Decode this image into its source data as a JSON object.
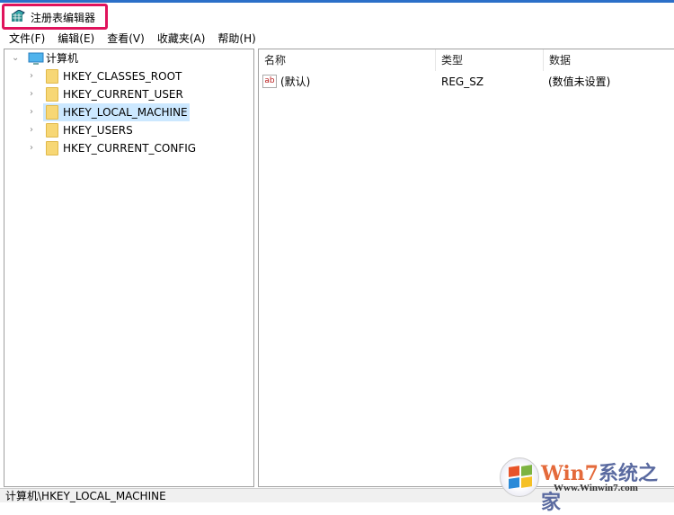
{
  "window": {
    "title": "注册表编辑器"
  },
  "menu": [
    "文件(F)",
    "编辑(E)",
    "查看(V)",
    "收藏夹(A)",
    "帮助(H)"
  ],
  "tree": {
    "root": "计算机",
    "children": [
      "HKEY_CLASSES_ROOT",
      "HKEY_CURRENT_USER",
      "HKEY_LOCAL_MACHINE",
      "HKEY_USERS",
      "HKEY_CURRENT_CONFIG"
    ],
    "selected": "HKEY_LOCAL_MACHINE"
  },
  "list": {
    "headers": [
      "名称",
      "类型",
      "数据"
    ],
    "rows": [
      {
        "name": "(默认)",
        "type": "REG_SZ",
        "data": "(数值未设置)",
        "icon": "ab"
      }
    ]
  },
  "status": "计算机\\HKEY_LOCAL_MACHINE",
  "watermark": {
    "brand": "Win7系统之家",
    "url": "Www.Winwin7.com"
  },
  "colors": {
    "highlight": "#e0135c",
    "selection": "#cce8ff"
  }
}
